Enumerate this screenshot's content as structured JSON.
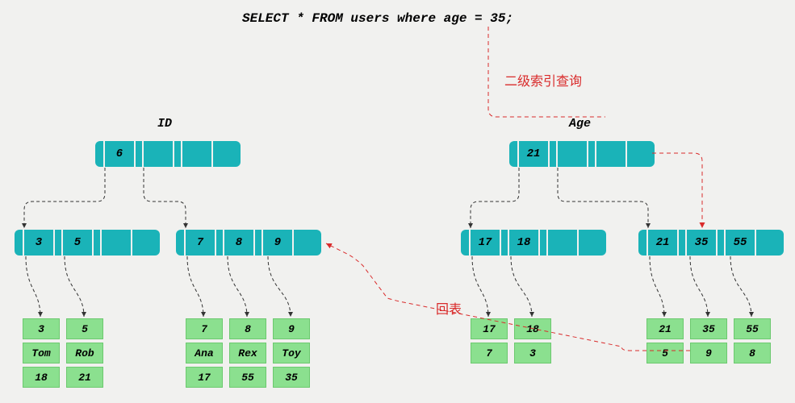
{
  "sql": "SELECT * FROM users where age = 35;",
  "left_tree": {
    "label": "ID",
    "root": [
      "6"
    ],
    "mid_left": [
      "3",
      "5"
    ],
    "mid_right": [
      "7",
      "8",
      "9"
    ],
    "leaves": [
      {
        "cells": [
          "3",
          "Tom",
          "18"
        ]
      },
      {
        "cells": [
          "5",
          "Rob",
          "21"
        ]
      },
      {
        "cells": [
          "7",
          "Ana",
          "17"
        ]
      },
      {
        "cells": [
          "8",
          "Rex",
          "55"
        ]
      },
      {
        "cells": [
          "9",
          "Toy",
          "35"
        ]
      }
    ]
  },
  "right_tree": {
    "label": "Age",
    "root": [
      "21"
    ],
    "mid_left": [
      "17",
      "18"
    ],
    "mid_right": [
      "21",
      "35",
      "55"
    ],
    "leaves": [
      {
        "cells": [
          "17",
          "7"
        ]
      },
      {
        "cells": [
          "18",
          "3"
        ]
      },
      {
        "cells": [
          "21",
          "5"
        ]
      },
      {
        "cells": [
          "35",
          "9"
        ]
      },
      {
        "cells": [
          "55",
          "8"
        ]
      }
    ]
  },
  "annotations": {
    "secondary_index_query": "二级索引查询",
    "back_to_table": "回表"
  },
  "chart_data": {
    "type": "table",
    "title": "B+ tree index lookup with secondary index and table lookback",
    "sql": "SELECT * FROM users where age = 35;",
    "primary_index_column": "ID",
    "primary_rows": [
      {
        "id": 3,
        "name": "Tom",
        "age": 18
      },
      {
        "id": 5,
        "name": "Rob",
        "age": 21
      },
      {
        "id": 7,
        "name": "Ana",
        "age": 17
      },
      {
        "id": 8,
        "name": "Rex",
        "age": 55
      },
      {
        "id": 9,
        "name": "Toy",
        "age": 35
      }
    ],
    "secondary_index_column": "Age",
    "secondary_entries": [
      {
        "age": 17,
        "id": 7
      },
      {
        "age": 18,
        "id": 3
      },
      {
        "age": 21,
        "id": 5
      },
      {
        "age": 35,
        "id": 9
      },
      {
        "age": 55,
        "id": 8
      }
    ],
    "lookup_path": [
      "Age tree root (21)",
      "right child (21,35,55)",
      "entry 35 -> id 9",
      "back to ID tree",
      "leaf id=9 (Toy,35)"
    ]
  }
}
